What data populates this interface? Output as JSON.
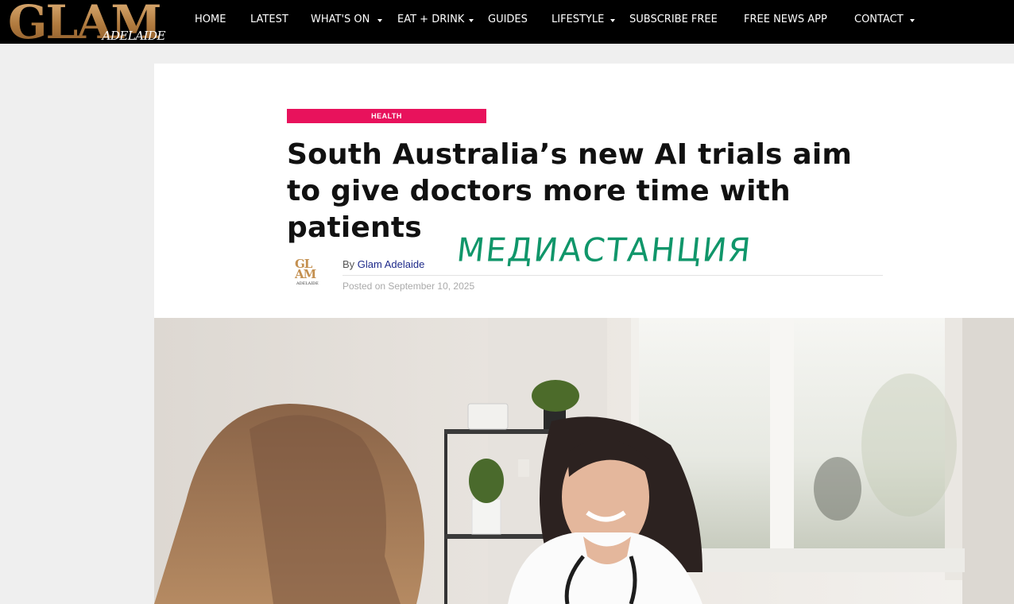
{
  "header": {
    "logo_main": "GLAM",
    "logo_sub": "ADELAIDE",
    "nav": [
      {
        "label": "HOME",
        "dropdown": false
      },
      {
        "label": "LATEST",
        "dropdown": false
      },
      {
        "label": "WHAT'S ON",
        "dropdown": true
      },
      {
        "label": "EAT + DRINK",
        "dropdown": true
      },
      {
        "label": "GUIDES",
        "dropdown": false
      },
      {
        "label": "LIFESTYLE",
        "dropdown": true
      },
      {
        "label": "SUBSCRIBE FREE",
        "dropdown": false
      },
      {
        "label": "FREE NEWS APP",
        "dropdown": false
      },
      {
        "label": "CONTACT",
        "dropdown": true
      }
    ]
  },
  "article": {
    "category": "HEALTH",
    "title": "South Australia’s new AI trials aim to give doctors more time with patients",
    "by_prefix": "By",
    "author": "Glam Adelaide",
    "posted": "Posted on September 10, 2025"
  },
  "avatar": {
    "line1": "GL",
    "line2": "AM",
    "sub": "ADELAIDE"
  },
  "watermark": "МЕДИАСТАНЦИЯ",
  "colors": {
    "category_bg": "#e8125c",
    "topbar_bg": "#000000",
    "logo_gold": "#b8864a",
    "watermark": "#10966a"
  }
}
